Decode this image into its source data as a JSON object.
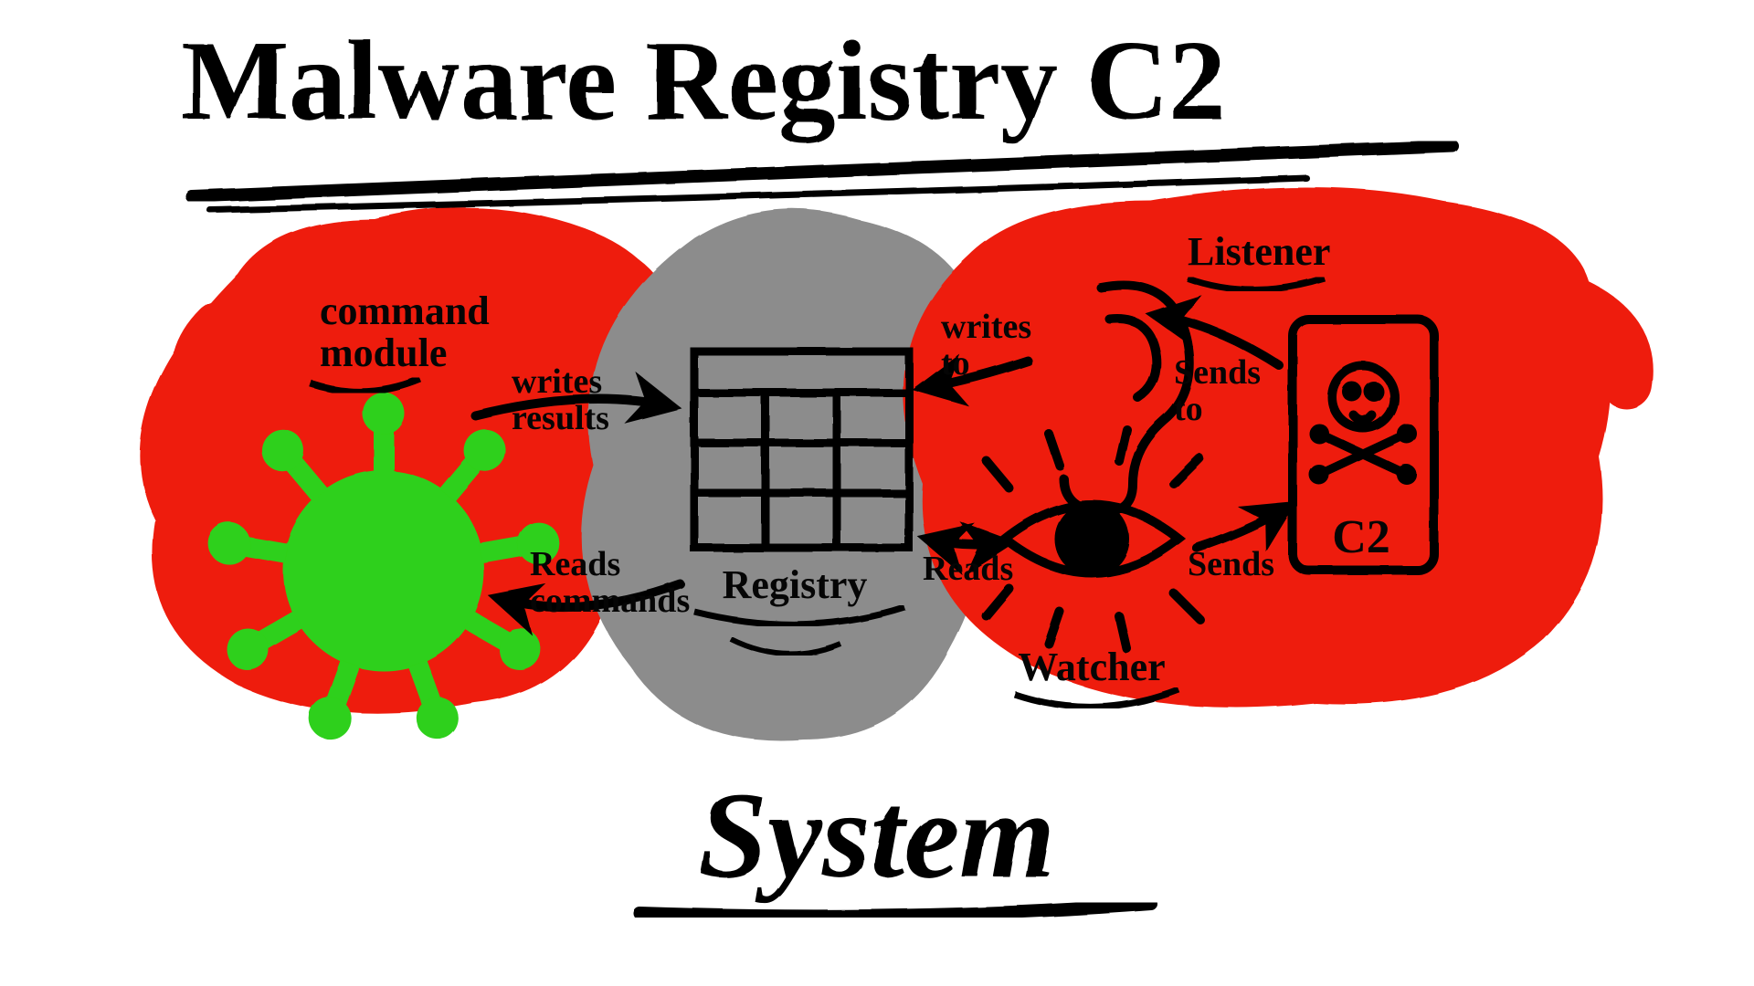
{
  "title_top": "Malware Registry C2",
  "title_bottom": "System",
  "nodes": {
    "command_module": "command\nmodule",
    "registry": "Registry",
    "listener": "Listener",
    "watcher": "Watcher",
    "c2": "C2"
  },
  "edges": {
    "writes_results": "writes\nresults",
    "reads_commands": "Reads\ncommands",
    "writes_to": "writes\nto",
    "reads": "Reads",
    "sends_to": "Sends\nto",
    "sends": "Sends"
  },
  "colors": {
    "red": "#ee1c0c",
    "grey": "#8c8c8c",
    "green": "#2fd01a",
    "ink": "#050505"
  }
}
